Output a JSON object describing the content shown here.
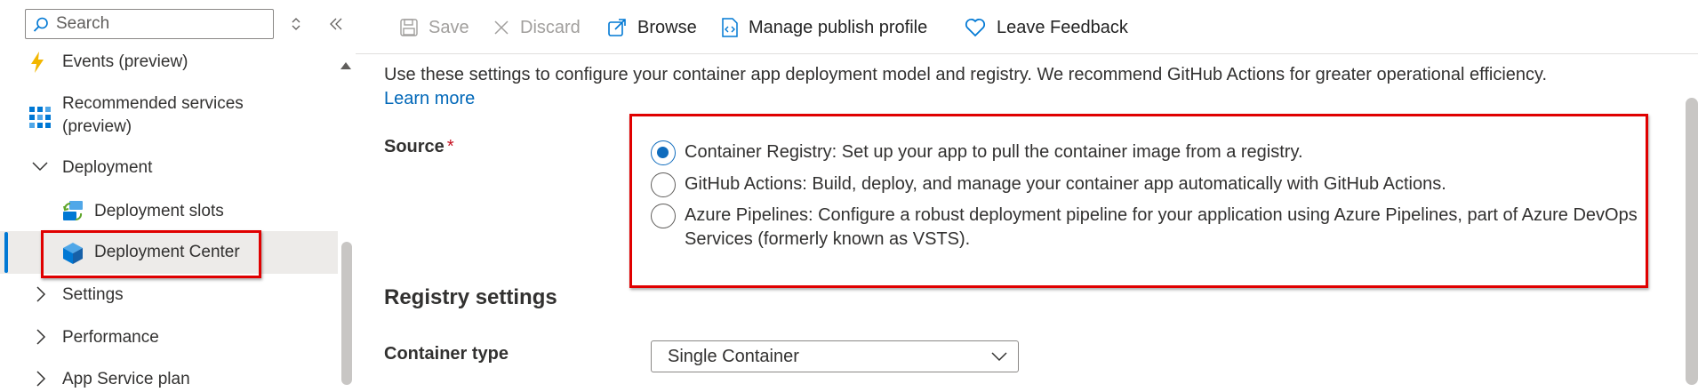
{
  "sidebar": {
    "search_placeholder": "Search",
    "items": {
      "events": {
        "label": "Events (preview)",
        "icon": "lightning-icon"
      },
      "recommended": {
        "label": "Recommended services (preview)",
        "label_line1": "Recommended services",
        "label_line2": "(preview)",
        "icon": "grid-icon"
      },
      "deployment": {
        "label": "Deployment",
        "icon": "chevron-down-icon"
      },
      "deployment_slots": {
        "label": "Deployment slots",
        "icon": "slots-icon"
      },
      "deployment_center": {
        "label": "Deployment Center",
        "icon": "cube-icon",
        "selected": true
      },
      "settings": {
        "label": "Settings",
        "icon": "chevron-right-icon"
      },
      "performance": {
        "label": "Performance",
        "icon": "chevron-right-icon"
      },
      "app_service_plan": {
        "label": "App Service plan",
        "icon": "chevron-right-icon"
      }
    }
  },
  "toolbar": {
    "save_label": "Save",
    "discard_label": "Discard",
    "browse_label": "Browse",
    "manage_publish_label": "Manage publish profile",
    "leave_feedback_label": "Leave Feedback"
  },
  "main": {
    "intro_text": "Use these settings to configure your container app deployment model and registry. We recommend GitHub Actions for greater operational efficiency.",
    "learn_more": "Learn more",
    "source_label": "Source",
    "required_mark": "*",
    "source_options": [
      {
        "label": "Container Registry: Set up your app to pull the container image from a registry.",
        "selected": true
      },
      {
        "label": "GitHub Actions: Build, deploy, and manage your container app automatically with GitHub Actions.",
        "selected": false
      },
      {
        "label": "Azure Pipelines: Configure a robust deployment pipeline for your application using Azure Pipelines, part of Azure DevOps Services (formerly known as VSTS).",
        "selected": false
      }
    ],
    "registry_settings_title": "Registry settings",
    "container_type_label": "Container type",
    "container_type_value": "Single Container"
  },
  "colors": {
    "accent": "#0078d4",
    "highlight_box": "#e00000",
    "required": "#c50f1f",
    "selected_bg": "#edebe9"
  }
}
